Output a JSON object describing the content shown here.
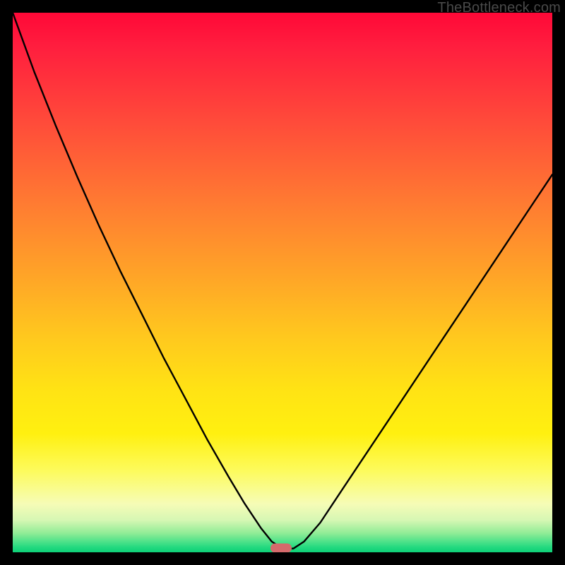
{
  "watermark": "TheBottleneck.com",
  "marker": {
    "x_frac": 0.498,
    "y_frac": 0.992
  },
  "chart_data": {
    "type": "line",
    "title": "",
    "xlabel": "",
    "ylabel": "",
    "xlim": [
      0,
      1
    ],
    "ylim": [
      0,
      1
    ],
    "grid": false,
    "legend": false,
    "note": "Axes are unlabeled; positions are expressed as fractions of the plot area (0=left/top, 1=right/bottom). Curve heights estimated from pixel positions.",
    "series": [
      {
        "name": "bottleneck-curve",
        "x": [
          0.0,
          0.04,
          0.08,
          0.12,
          0.16,
          0.2,
          0.24,
          0.28,
          0.32,
          0.36,
          0.4,
          0.43,
          0.46,
          0.48,
          0.5,
          0.52,
          0.54,
          0.57,
          0.61,
          0.66,
          0.72,
          0.78,
          0.84,
          0.9,
          0.96,
          1.0
        ],
        "y": [
          0.0,
          0.11,
          0.21,
          0.305,
          0.395,
          0.48,
          0.56,
          0.64,
          0.715,
          0.79,
          0.86,
          0.91,
          0.955,
          0.98,
          0.993,
          0.993,
          0.98,
          0.945,
          0.885,
          0.81,
          0.72,
          0.63,
          0.54,
          0.45,
          0.36,
          0.3
        ]
      }
    ],
    "background_gradient_stops": [
      {
        "pos": 0.0,
        "color": "#ff0837"
      },
      {
        "pos": 0.06,
        "color": "#ff1d3e"
      },
      {
        "pos": 0.2,
        "color": "#ff4a3a"
      },
      {
        "pos": 0.35,
        "color": "#ff7a32"
      },
      {
        "pos": 0.48,
        "color": "#ffa228"
      },
      {
        "pos": 0.6,
        "color": "#ffc81e"
      },
      {
        "pos": 0.7,
        "color": "#ffe314"
      },
      {
        "pos": 0.78,
        "color": "#fff010"
      },
      {
        "pos": 0.85,
        "color": "#fdfb5e"
      },
      {
        "pos": 0.91,
        "color": "#f6fcb6"
      },
      {
        "pos": 0.94,
        "color": "#d7f7b4"
      },
      {
        "pos": 0.965,
        "color": "#8fec96"
      },
      {
        "pos": 0.98,
        "color": "#4fe28a"
      },
      {
        "pos": 0.992,
        "color": "#1fd87e"
      },
      {
        "pos": 1.0,
        "color": "#0ed178"
      }
    ],
    "marker": {
      "x": 0.498,
      "y": 0.992,
      "color": "#d56a6b"
    }
  }
}
